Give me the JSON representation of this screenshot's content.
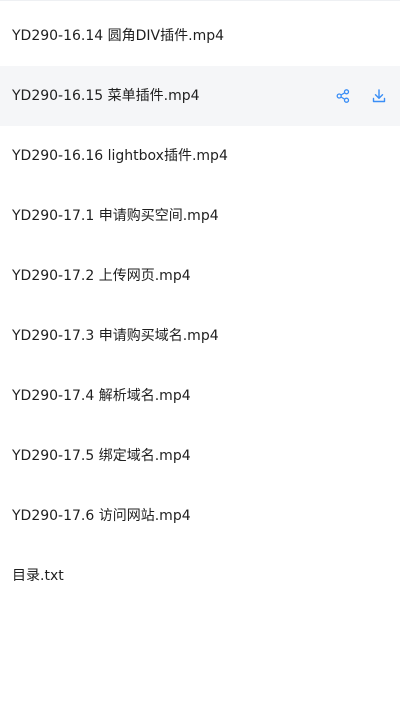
{
  "accent_color": "#3a8ef6",
  "files": [
    {
      "name": "YD290-16.14 圆角DIV插件.mp4"
    },
    {
      "name": "YD290-16.15 菜单插件.mp4",
      "highlighted": true,
      "actions": [
        "share-icon",
        "download-icon"
      ]
    },
    {
      "name": "YD290-16.16 lightbox插件.mp4"
    },
    {
      "name": "YD290-17.1 申请购买空间.mp4"
    },
    {
      "name": "YD290-17.2 上传网页.mp4"
    },
    {
      "name": "YD290-17.3 申请购买域名.mp4"
    },
    {
      "name": "YD290-17.4 解析域名.mp4"
    },
    {
      "name": "YD290-17.5 绑定域名.mp4"
    },
    {
      "name": "YD290-17.6 访问网站.mp4"
    },
    {
      "name": "目录.txt"
    }
  ]
}
